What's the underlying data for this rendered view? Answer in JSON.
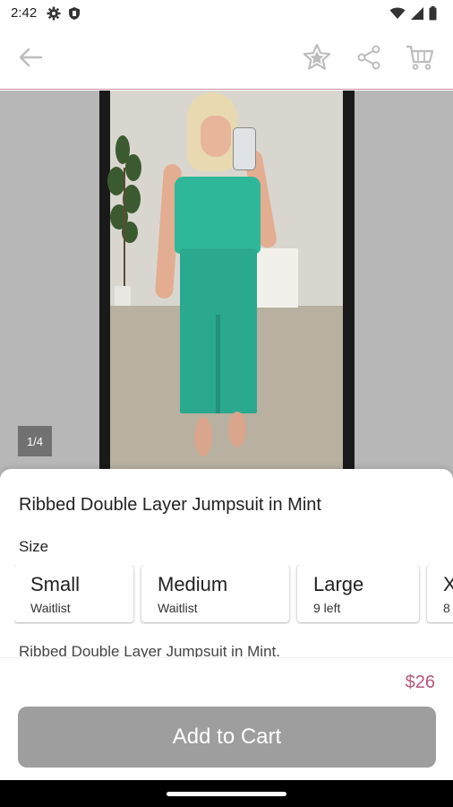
{
  "status_bar": {
    "time": "2:42",
    "left_icons": [
      "gear-icon",
      "shield-icon"
    ],
    "right_icons": [
      "wifi-icon",
      "signal-icon",
      "battery-icon"
    ]
  },
  "app_bar": {
    "icons": [
      "back-arrow-icon",
      "star-icon",
      "share-icon",
      "cart-icon"
    ],
    "accent_color": "#c98aa0"
  },
  "gallery": {
    "counter": "1/4"
  },
  "product": {
    "title": "Ribbed Double Layer Jumpsuit in Mint",
    "size_label": "Size",
    "sizes": [
      {
        "name": "Small",
        "status": "Waitlist"
      },
      {
        "name": "Medium",
        "status": "Waitlist"
      },
      {
        "name": "Large",
        "status": "9 left"
      },
      {
        "name": "X",
        "status": "8"
      }
    ],
    "description": "Ribbed Double Layer Jumpsuit in Mint.",
    "price": "$26",
    "price_color": "#b5577a"
  },
  "actions": {
    "add_to_cart": "Add to Cart",
    "button_color": "#9e9e9e"
  }
}
